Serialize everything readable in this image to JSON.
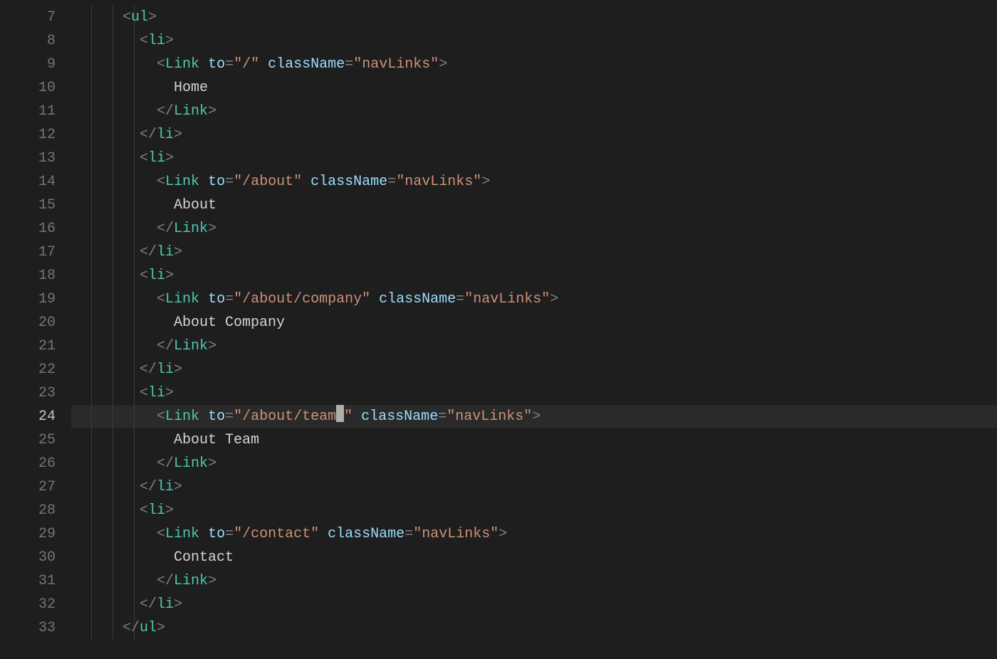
{
  "editor": {
    "activeLine": 24,
    "indentGuides": [
      28,
      58,
      88
    ],
    "lineNumbers": [
      "7",
      "8",
      "9",
      "10",
      "11",
      "12",
      "13",
      "14",
      "15",
      "16",
      "17",
      "18",
      "19",
      "20",
      "21",
      "22",
      "23",
      "24",
      "25",
      "26",
      "27",
      "28",
      "29",
      "30",
      "31",
      "32",
      "33"
    ],
    "lines": [
      {
        "n": 7,
        "indent": 3,
        "tokens": [
          [
            "pn",
            "<"
          ],
          [
            "tg",
            "ul"
          ],
          [
            "pn",
            ">"
          ]
        ]
      },
      {
        "n": 8,
        "indent": 4,
        "tokens": [
          [
            "pn",
            "<"
          ],
          [
            "tg",
            "li"
          ],
          [
            "pn",
            ">"
          ]
        ]
      },
      {
        "n": 9,
        "indent": 5,
        "tokens": [
          [
            "pn",
            "<"
          ],
          [
            "tg",
            "Link"
          ],
          [
            "tx",
            " "
          ],
          [
            "at",
            "to"
          ],
          [
            "pn",
            "="
          ],
          [
            "st",
            "\"/\""
          ],
          [
            "tx",
            " "
          ],
          [
            "at",
            "className"
          ],
          [
            "pn",
            "="
          ],
          [
            "st",
            "\"navLinks\""
          ],
          [
            "pn",
            ">"
          ]
        ]
      },
      {
        "n": 10,
        "indent": 6,
        "tokens": [
          [
            "tx",
            "Home"
          ]
        ]
      },
      {
        "n": 11,
        "indent": 5,
        "tokens": [
          [
            "pn",
            "</"
          ],
          [
            "tg",
            "Link"
          ],
          [
            "pn",
            ">"
          ]
        ]
      },
      {
        "n": 12,
        "indent": 4,
        "tokens": [
          [
            "pn",
            "</"
          ],
          [
            "tg",
            "li"
          ],
          [
            "pn",
            ">"
          ]
        ]
      },
      {
        "n": 13,
        "indent": 4,
        "tokens": [
          [
            "pn",
            "<"
          ],
          [
            "tg",
            "li"
          ],
          [
            "pn",
            ">"
          ]
        ]
      },
      {
        "n": 14,
        "indent": 5,
        "tokens": [
          [
            "pn",
            "<"
          ],
          [
            "tg",
            "Link"
          ],
          [
            "tx",
            " "
          ],
          [
            "at",
            "to"
          ],
          [
            "pn",
            "="
          ],
          [
            "st",
            "\"/about\""
          ],
          [
            "tx",
            " "
          ],
          [
            "at",
            "className"
          ],
          [
            "pn",
            "="
          ],
          [
            "st",
            "\"navLinks\""
          ],
          [
            "pn",
            ">"
          ]
        ]
      },
      {
        "n": 15,
        "indent": 6,
        "tokens": [
          [
            "tx",
            "About"
          ]
        ]
      },
      {
        "n": 16,
        "indent": 5,
        "tokens": [
          [
            "pn",
            "</"
          ],
          [
            "tg",
            "Link"
          ],
          [
            "pn",
            ">"
          ]
        ]
      },
      {
        "n": 17,
        "indent": 4,
        "tokens": [
          [
            "pn",
            "</"
          ],
          [
            "tg",
            "li"
          ],
          [
            "pn",
            ">"
          ]
        ]
      },
      {
        "n": 18,
        "indent": 4,
        "tokens": [
          [
            "pn",
            "<"
          ],
          [
            "tg",
            "li"
          ],
          [
            "pn",
            ">"
          ]
        ]
      },
      {
        "n": 19,
        "indent": 5,
        "tokens": [
          [
            "pn",
            "<"
          ],
          [
            "tg",
            "Link"
          ],
          [
            "tx",
            " "
          ],
          [
            "at",
            "to"
          ],
          [
            "pn",
            "="
          ],
          [
            "st",
            "\"/about/company\""
          ],
          [
            "tx",
            " "
          ],
          [
            "at",
            "className"
          ],
          [
            "pn",
            "="
          ],
          [
            "st",
            "\"navLinks\""
          ],
          [
            "pn",
            ">"
          ]
        ]
      },
      {
        "n": 20,
        "indent": 6,
        "tokens": [
          [
            "tx",
            "About Company"
          ]
        ]
      },
      {
        "n": 21,
        "indent": 5,
        "tokens": [
          [
            "pn",
            "</"
          ],
          [
            "tg",
            "Link"
          ],
          [
            "pn",
            ">"
          ]
        ]
      },
      {
        "n": 22,
        "indent": 4,
        "tokens": [
          [
            "pn",
            "</"
          ],
          [
            "tg",
            "li"
          ],
          [
            "pn",
            ">"
          ]
        ]
      },
      {
        "n": 23,
        "indent": 4,
        "tokens": [
          [
            "pn",
            "<"
          ],
          [
            "tg",
            "li"
          ],
          [
            "pn",
            ">"
          ]
        ]
      },
      {
        "n": 24,
        "indent": 5,
        "cursorAfter": 8,
        "tokens": [
          [
            "pn",
            "<"
          ],
          [
            "tg",
            "Link"
          ],
          [
            "tx",
            " "
          ],
          [
            "at",
            "to"
          ],
          [
            "pn",
            "="
          ],
          [
            "st",
            "\"/about/team"
          ],
          [
            "cursor",
            ""
          ],
          [
            "st",
            "\""
          ],
          [
            "tx",
            " "
          ],
          [
            "at",
            "className"
          ],
          [
            "pn",
            "="
          ],
          [
            "st",
            "\"navLinks\""
          ],
          [
            "pn",
            ">"
          ]
        ]
      },
      {
        "n": 25,
        "indent": 6,
        "tokens": [
          [
            "tx",
            "About Team"
          ]
        ]
      },
      {
        "n": 26,
        "indent": 5,
        "tokens": [
          [
            "pn",
            "</"
          ],
          [
            "tg",
            "Link"
          ],
          [
            "pn",
            ">"
          ]
        ]
      },
      {
        "n": 27,
        "indent": 4,
        "tokens": [
          [
            "pn",
            "</"
          ],
          [
            "tg",
            "li"
          ],
          [
            "pn",
            ">"
          ]
        ]
      },
      {
        "n": 28,
        "indent": 4,
        "tokens": [
          [
            "pn",
            "<"
          ],
          [
            "tg",
            "li"
          ],
          [
            "pn",
            ">"
          ]
        ]
      },
      {
        "n": 29,
        "indent": 5,
        "tokens": [
          [
            "pn",
            "<"
          ],
          [
            "tg",
            "Link"
          ],
          [
            "tx",
            " "
          ],
          [
            "at",
            "to"
          ],
          [
            "pn",
            "="
          ],
          [
            "st",
            "\"/contact\""
          ],
          [
            "tx",
            " "
          ],
          [
            "at",
            "className"
          ],
          [
            "pn",
            "="
          ],
          [
            "st",
            "\"navLinks\""
          ],
          [
            "pn",
            ">"
          ]
        ]
      },
      {
        "n": 30,
        "indent": 6,
        "tokens": [
          [
            "tx",
            "Contact"
          ]
        ]
      },
      {
        "n": 31,
        "indent": 5,
        "tokens": [
          [
            "pn",
            "</"
          ],
          [
            "tg",
            "Link"
          ],
          [
            "pn",
            ">"
          ]
        ]
      },
      {
        "n": 32,
        "indent": 4,
        "tokens": [
          [
            "pn",
            "</"
          ],
          [
            "tg",
            "li"
          ],
          [
            "pn",
            ">"
          ]
        ]
      },
      {
        "n": 33,
        "indent": 3,
        "tokens": [
          [
            "pn",
            "</"
          ],
          [
            "tg",
            "ul"
          ],
          [
            "pn",
            ">"
          ]
        ]
      }
    ]
  }
}
